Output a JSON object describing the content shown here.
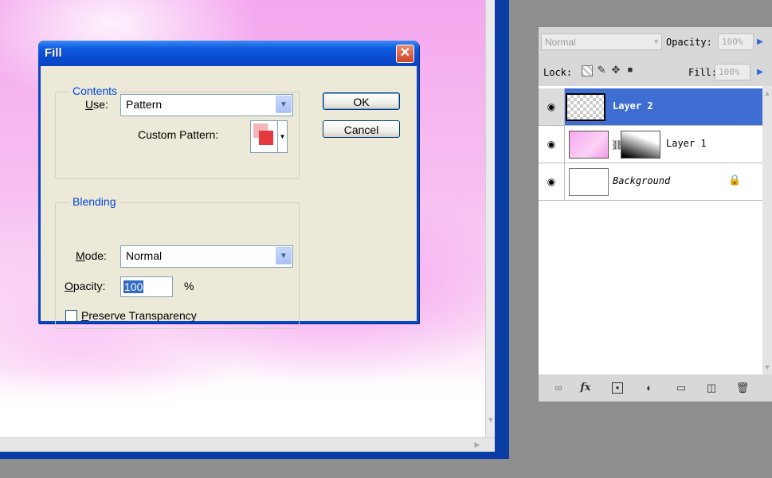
{
  "fill_dialog": {
    "title": "Fill",
    "close_glyph": "✕",
    "contents": {
      "legend": "Contents",
      "use_label_underline": "U",
      "use_label_rest": "se:",
      "use_value": "Pattern",
      "custom_pattern_label": "Custom Pattern:"
    },
    "ok_label": "OK",
    "cancel_label": "Cancel",
    "blending": {
      "legend": "Blending",
      "mode_label_underline": "M",
      "mode_label_rest": "ode:",
      "mode_value": "Normal",
      "opacity_label_underline": "O",
      "opacity_label_rest": "pacity:",
      "opacity_value": "100",
      "opacity_unit": "%",
      "preserve_label_underline": "P",
      "preserve_label_rest": "reserve Transparency",
      "preserve_checked": false
    }
  },
  "layers_panel": {
    "blend_mode": "Normal",
    "opacity_label": "Opacity:",
    "opacity_value": "100%",
    "lock_label": "Lock:",
    "fill_label": "Fill:",
    "fill_value": "100%",
    "icons": {
      "lock_transparent": "transparent-pixels-lock-icon",
      "lock_image": "brush-lock-icon",
      "lock_position": "move-lock-icon",
      "lock_all": "lock-all-icon",
      "visibility": "eye-icon",
      "link": "chain-icon",
      "footer": [
        "link-layers-icon",
        "fx-icon",
        "mask-icon",
        "adjustment-icon",
        "folder-icon",
        "new-layer-icon",
        "trash-icon"
      ]
    },
    "layers": [
      {
        "name": "Layer 2",
        "selected": true,
        "visible": true
      },
      {
        "name": "Layer 1",
        "selected": false,
        "visible": true,
        "has_mask": true
      },
      {
        "name": "Background",
        "selected": false,
        "visible": true,
        "locked": true
      }
    ],
    "footer_fx": "fx"
  },
  "colors": {
    "dialog_title_blue": "#0a46c8",
    "legend_blue": "#0046d5",
    "layer_selected": "#3e6ed2",
    "pattern_red": "#e8383f"
  }
}
